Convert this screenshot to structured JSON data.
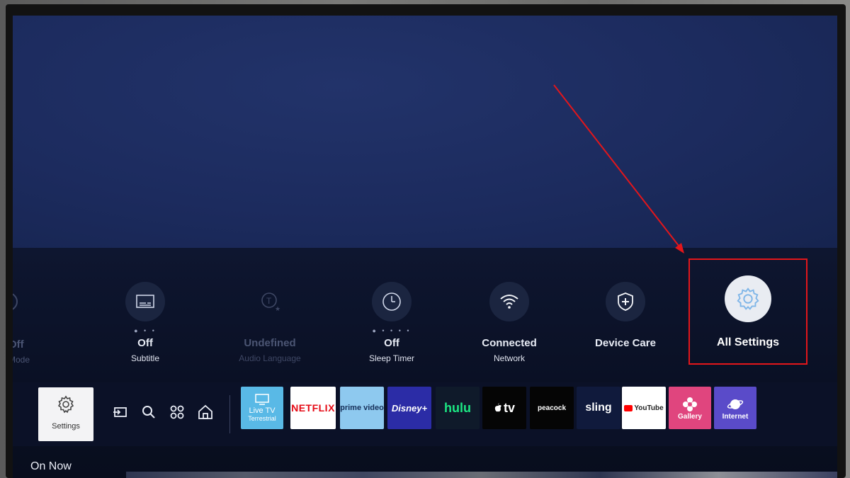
{
  "quick_settings": {
    "partial_left": {
      "value": "Off",
      "label": "Mode"
    },
    "items": [
      {
        "value": "Off",
        "label": "Subtitle",
        "dots": "● • •"
      },
      {
        "value": "Undefined",
        "label": "Audio Language",
        "dots": ""
      },
      {
        "value": "Off",
        "label": "Sleep Timer",
        "dots": "● • • • •"
      },
      {
        "value": "Connected",
        "label": "Network",
        "dots": ""
      },
      {
        "value": "Device Care",
        "label": "",
        "dots": ""
      }
    ],
    "all_settings": {
      "label": "All Settings"
    }
  },
  "app_bar": {
    "settings_label": "Settings",
    "apps": [
      {
        "name": "Live TV",
        "sub": "Terrestrial"
      },
      {
        "name": "NETFLIX"
      },
      {
        "name": "prime video"
      },
      {
        "name": "Disney+"
      },
      {
        "name": "hulu"
      },
      {
        "name": "tv"
      },
      {
        "name": "peacock"
      },
      {
        "name": "sling"
      },
      {
        "name": "YouTube"
      },
      {
        "name": "Gallery"
      },
      {
        "name": "Internet"
      }
    ]
  },
  "on_now": {
    "label": "On Now"
  },
  "colors": {
    "highlight": "#e3161b",
    "panel": "#0a1024",
    "screen": "#1c2b5e"
  },
  "icons": [
    "input-icon",
    "search-icon",
    "apps-icon",
    "home-icon",
    "gear-icon",
    "wifi-icon",
    "shield-icon",
    "timer-icon",
    "subtitle-icon",
    "speech-icon"
  ]
}
